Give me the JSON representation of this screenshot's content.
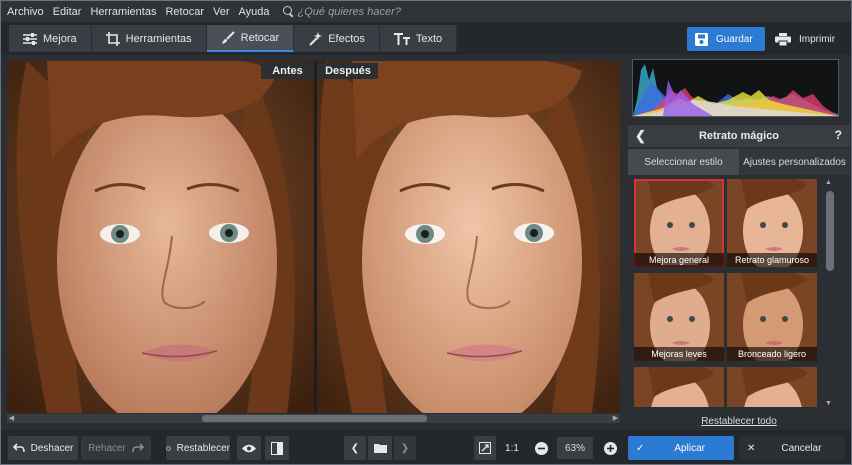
{
  "menu": {
    "items": [
      "Archivo",
      "Editar",
      "Herramientas",
      "Retocar",
      "Ver",
      "Ayuda"
    ],
    "search_placeholder": "¿Qué quieres hacer?"
  },
  "tabs": [
    {
      "label": "Mejora",
      "icon": "sliders-icon"
    },
    {
      "label": "Herramientas",
      "icon": "crop-icon"
    },
    {
      "label": "Retocar",
      "icon": "brush-icon",
      "active": true
    },
    {
      "label": "Efectos",
      "icon": "magic-wand-icon"
    },
    {
      "label": "Texto",
      "icon": "text-icon"
    }
  ],
  "toolbar": {
    "save_label": "Guardar",
    "print_label": "Imprimir"
  },
  "viewer": {
    "before_label": "Antes",
    "after_label": "Después"
  },
  "panel": {
    "title": "Retrato mágico",
    "back_icon": "chevron-left-icon",
    "help": "?",
    "subtabs": [
      "Seleccionar estilo",
      "Ajustes personalizados"
    ],
    "styles": [
      {
        "label": "Mejora general",
        "selected": true
      },
      {
        "label": "Retrato glamuroso"
      },
      {
        "label": "Mejoras leves"
      },
      {
        "label": "Bronceado ligero"
      },
      {
        "label": ""
      },
      {
        "label": ""
      }
    ],
    "reset_label": "Restablecer todo"
  },
  "bottom": {
    "undo_label": "Deshacer",
    "redo_label": "Rehacer",
    "reset_label": "Restablecer",
    "ratio_label": "1:1",
    "zoom": "63%",
    "apply_label": "Aplicar",
    "cancel_label": "Cancelar"
  },
  "colors": {
    "accent": "#2a7bd1",
    "selection": "#d6303a",
    "background": "#2b2e33"
  }
}
